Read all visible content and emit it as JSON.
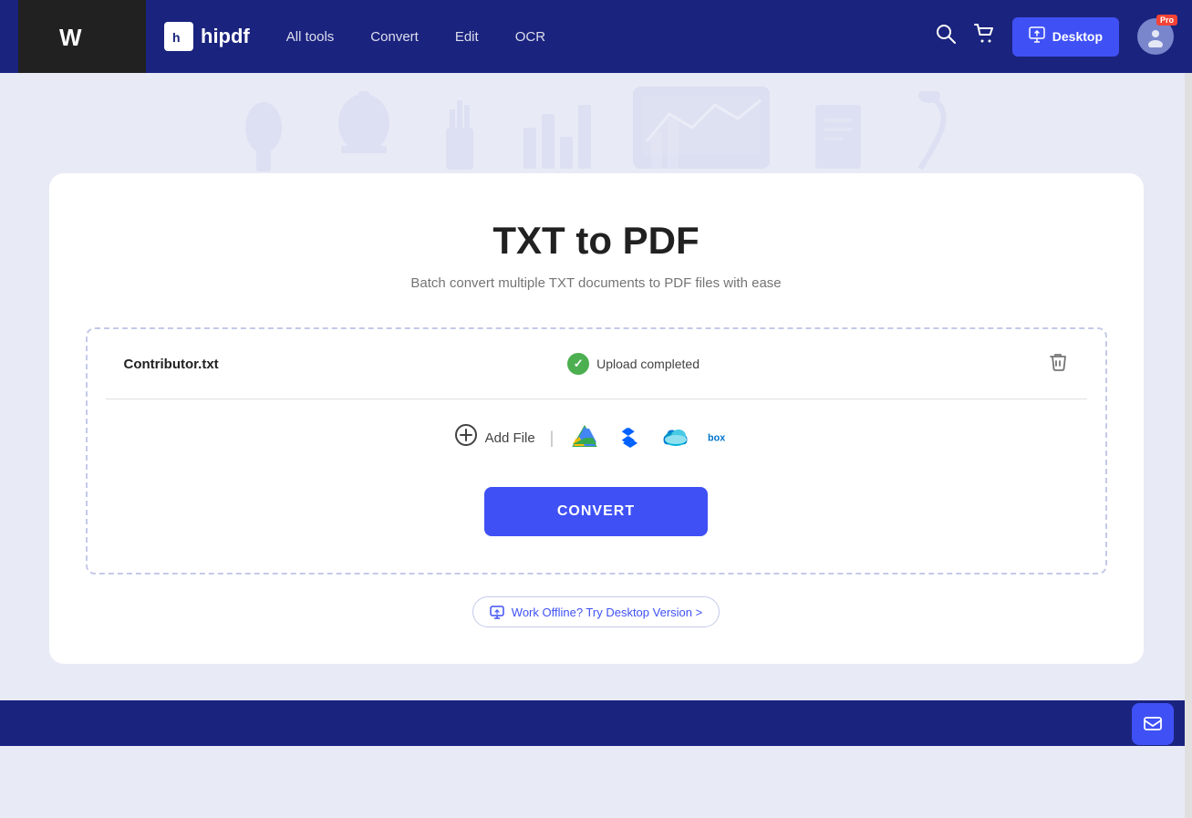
{
  "brand": {
    "wondershare_label": "ws",
    "hipdf_label": "hipdf",
    "h_char": "h"
  },
  "navbar": {
    "all_tools": "All tools",
    "convert": "Convert",
    "edit": "Edit",
    "ocr": "OCR",
    "desktop_btn": "Desktop",
    "pro_badge": "Pro"
  },
  "page": {
    "title": "TXT to PDF",
    "subtitle": "Batch convert multiple TXT documents to PDF files with ease"
  },
  "file": {
    "name": "Contributor.txt",
    "status": "Upload completed"
  },
  "actions": {
    "add_file": "Add File",
    "convert": "CONVERT",
    "offline_text": "Work Offline? Try Desktop Version >"
  }
}
